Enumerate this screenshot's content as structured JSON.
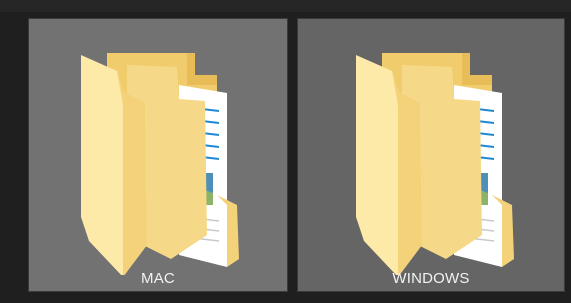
{
  "folders": [
    {
      "label": "MAC",
      "icon": "folder-icon"
    },
    {
      "label": "WINDOWS",
      "icon": "folder-icon"
    }
  ],
  "colors": {
    "background": "#1f1f1f",
    "tile_mac": "#727272",
    "tile_windows": "#656565",
    "folder_light": "#fbe6a0",
    "folder_mid": "#f2cd6e",
    "folder_dark": "#e2b552",
    "paper": "#ffffff",
    "paper_lines": "#1f8ad1",
    "label_text": "#f2f2f2"
  }
}
